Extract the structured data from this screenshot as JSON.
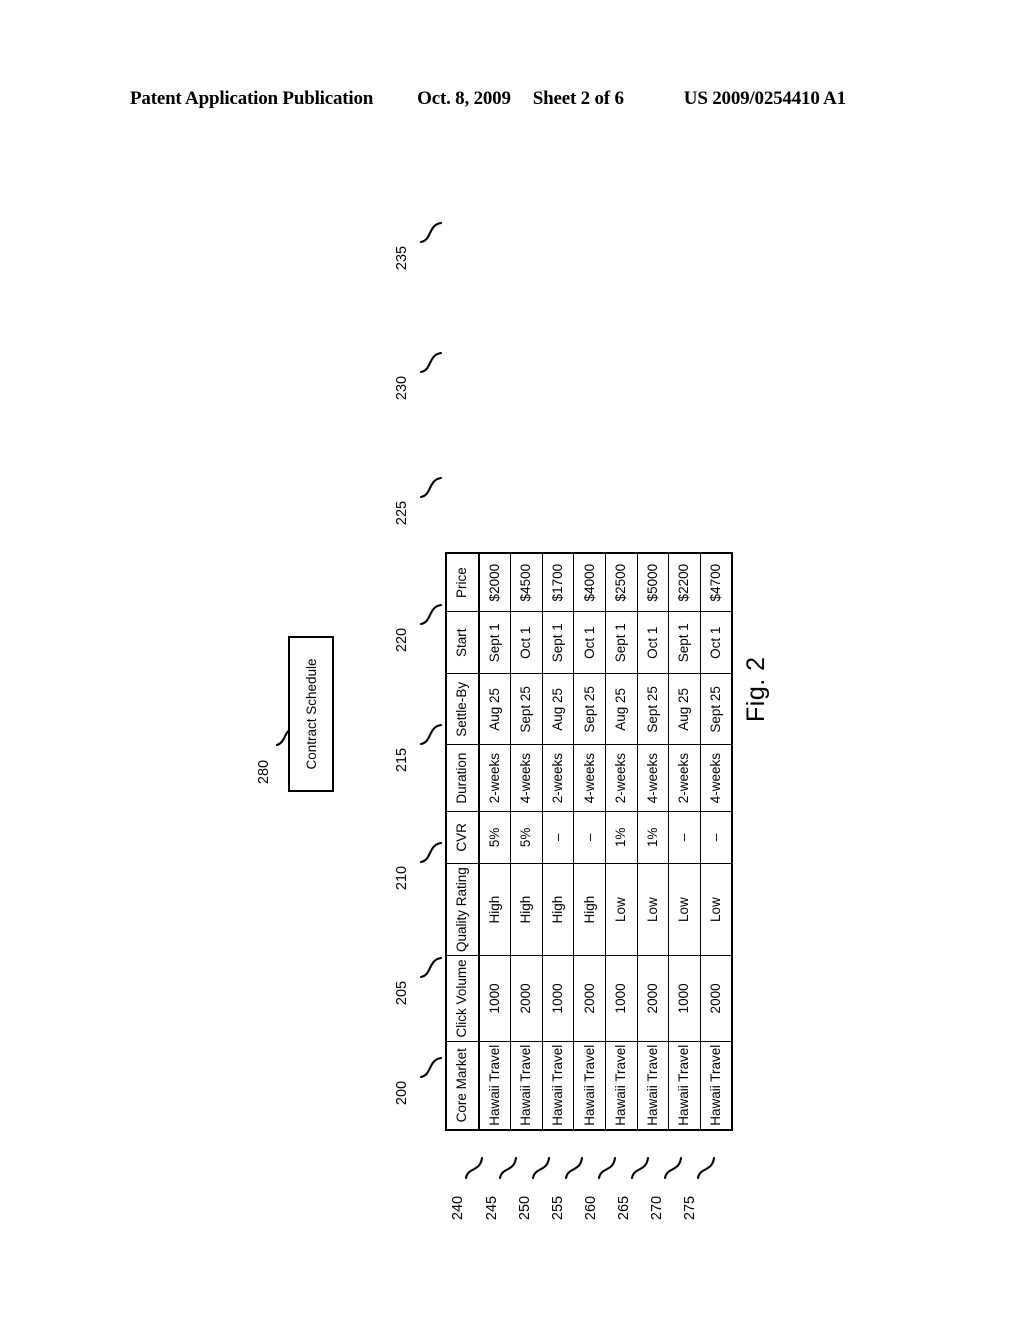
{
  "header": {
    "publication": "Patent Application Publication",
    "date": "Oct. 8, 2009",
    "sheet": "Sheet 2 of 6",
    "doc_number": "US 2009/0254410 A1"
  },
  "figure": {
    "label": "Fig. 2",
    "callout_box": {
      "text": "Contract Schedule",
      "ref": "280"
    }
  },
  "table": {
    "columns": [
      {
        "header": "Core Market",
        "ref": "200"
      },
      {
        "header": "Click Volume",
        "ref": "205"
      },
      {
        "header": "Quality Rating",
        "ref": "210"
      },
      {
        "header": "CVR",
        "ref": "215"
      },
      {
        "header": "Duration",
        "ref": "220"
      },
      {
        "header": "Settle-By",
        "ref": "225"
      },
      {
        "header": "Start",
        "ref": "230"
      },
      {
        "header": "Price",
        "ref": "235"
      }
    ],
    "rows": [
      {
        "ref": "240",
        "cells": [
          "Hawaii Travel",
          "1000",
          "High",
          "5%",
          "2-weeks",
          "Aug 25",
          "Sept 1",
          "$2000"
        ]
      },
      {
        "ref": "245",
        "cells": [
          "Hawaii Travel",
          "2000",
          "High",
          "5%",
          "4-weeks",
          "Sept 25",
          "Oct 1",
          "$4500"
        ]
      },
      {
        "ref": "250",
        "cells": [
          "Hawaii Travel",
          "1000",
          "High",
          "–",
          "2-weeks",
          "Aug 25",
          "Sept 1",
          "$1700"
        ]
      },
      {
        "ref": "255",
        "cells": [
          "Hawaii Travel",
          "2000",
          "High",
          "–",
          "4-weeks",
          "Sept 25",
          "Oct 1",
          "$4000"
        ]
      },
      {
        "ref": "260",
        "cells": [
          "Hawaii Travel",
          "1000",
          "Low",
          "1%",
          "2-weeks",
          "Aug 25",
          "Sept 1",
          "$2500"
        ]
      },
      {
        "ref": "265",
        "cells": [
          "Hawaii Travel",
          "2000",
          "Low",
          "1%",
          "4-weeks",
          "Sept 25",
          "Oct 1",
          "$5000"
        ]
      },
      {
        "ref": "270",
        "cells": [
          "Hawaii Travel",
          "1000",
          "Low",
          "–",
          "2-weeks",
          "Aug 25",
          "Sept 1",
          "$2200"
        ]
      },
      {
        "ref": "275",
        "cells": [
          "Hawaii Travel",
          "2000",
          "Low",
          "–",
          "4-weeks",
          "Sept 25",
          "Oct 1",
          "$4700"
        ]
      }
    ]
  },
  "colors": {
    "ink": "#000000",
    "paper": "#ffffff"
  }
}
